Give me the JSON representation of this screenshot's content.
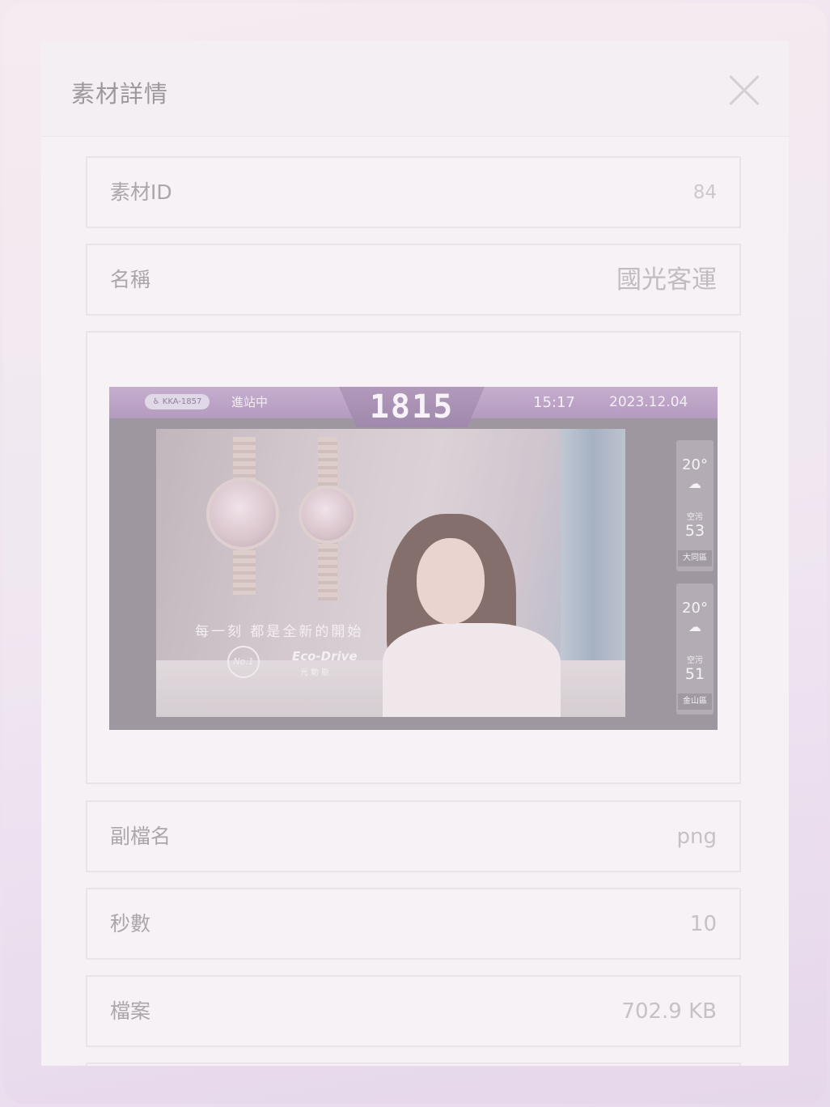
{
  "modal": {
    "title": "素材詳情",
    "close_icon": "close-icon"
  },
  "fields": [
    {
      "label": "素材ID",
      "value": "84"
    },
    {
      "label": "名稱",
      "value": "國光客運"
    },
    {
      "label": "副檔名",
      "value": "png"
    },
    {
      "label": "秒數",
      "value": "10"
    },
    {
      "label": "檔案",
      "value": "702.9 KB"
    }
  ],
  "preview": {
    "accessible_badge": "KKA-1857",
    "status": "進站中",
    "route": "1815",
    "time": "15:17",
    "date": "2023.12.04",
    "ad": {
      "slogan": "每一刻 都是全新的開始",
      "badge": "No.1",
      "brand": "Eco-Drive",
      "brand_sub": "光動能"
    },
    "weather": [
      {
        "temp": "20°",
        "icon": "rain-cloud-icon",
        "aqi_label": "空污",
        "aqi": "53",
        "district": "大同區"
      },
      {
        "temp": "20°",
        "icon": "rain-cloud-icon",
        "aqi_label": "空污",
        "aqi": "51",
        "district": "金山區"
      }
    ]
  }
}
